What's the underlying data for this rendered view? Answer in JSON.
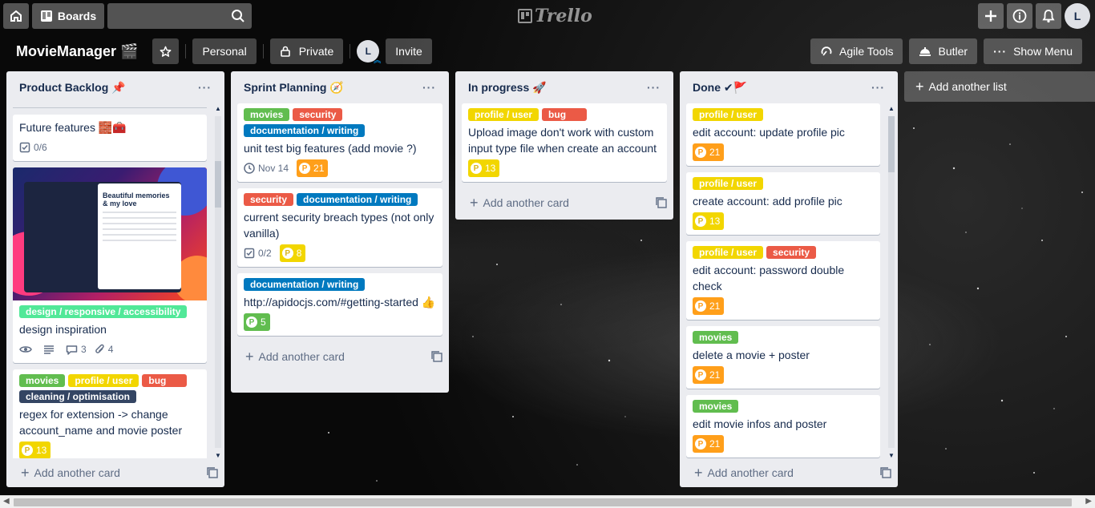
{
  "header": {
    "boards_label": "Boards",
    "search_placeholder": "",
    "logo": "Trello",
    "avatar": "L"
  },
  "board": {
    "title": "MovieManager 🎬",
    "visibility_team": "Personal",
    "visibility_privacy": "Private",
    "member": "L",
    "invite": "Invite",
    "agile_tools": "Agile Tools",
    "butler": "Butler",
    "show_menu": "Show Menu",
    "add_list": "Add another list"
  },
  "colors": {
    "green": "#61bd4f",
    "yellow": "#f2d600",
    "red": "#eb5a46",
    "blue": "#0079bf",
    "lime": "#51e898",
    "navy": "#344563",
    "orange": "#ff9f1a"
  },
  "lists": [
    {
      "title": "Product Backlog 📌",
      "add_card": "Add another card",
      "cards": [
        {
          "title": "Future features 🧱🧰",
          "checklist": "0/6"
        },
        {
          "cover_text": "Beautiful memories & my love",
          "labels": [
            {
              "text": "design / responsive / accessibility",
              "color": "lime"
            }
          ],
          "title": "design inspiration",
          "comments": "3",
          "attachments": "4"
        },
        {
          "labels": [
            {
              "text": "movies",
              "color": "green"
            },
            {
              "text": "profile / user",
              "color": "yellow"
            },
            {
              "text": "bug",
              "color": "red"
            },
            {
              "text": "cleaning / optimisation",
              "color": "navy"
            }
          ],
          "title": "regex for extension -> change account_name and movie poster",
          "points": "13"
        }
      ]
    },
    {
      "title": "Sprint Planning 🧭",
      "add_card": "Add another card",
      "cards": [
        {
          "labels": [
            {
              "text": "movies",
              "color": "green"
            },
            {
              "text": "security",
              "color": "red"
            },
            {
              "text": "documentation / writing",
              "color": "blue"
            }
          ],
          "title": "unit test big features (add movie ?)",
          "due": "Nov 14",
          "points": "21"
        },
        {
          "labels": [
            {
              "text": "security",
              "color": "red"
            },
            {
              "text": "documentation / writing",
              "color": "blue"
            }
          ],
          "title": "current security breach types (not only vanilla)",
          "checklist": "0/2",
          "points": "8"
        },
        {
          "labels": [
            {
              "text": "documentation / writing",
              "color": "blue"
            }
          ],
          "title": "http://apidocjs.com/#getting-started 👍",
          "points": "5"
        }
      ]
    },
    {
      "title": "In progress 🚀",
      "add_card": "Add another card",
      "cards": [
        {
          "labels": [
            {
              "text": "profile / user",
              "color": "yellow"
            },
            {
              "text": "bug",
              "color": "red"
            }
          ],
          "title": "Upload image don't work with custom input type file when create an account",
          "points": "13"
        }
      ]
    },
    {
      "title": "Done ✔🚩",
      "add_card": "Add another card",
      "cards": [
        {
          "labels": [
            {
              "text": "profile / user",
              "color": "yellow"
            }
          ],
          "title": "edit account: update profile pic",
          "points": "21"
        },
        {
          "labels": [
            {
              "text": "profile / user",
              "color": "yellow"
            }
          ],
          "title": "create account: add profile pic",
          "points": "13"
        },
        {
          "labels": [
            {
              "text": "profile / user",
              "color": "yellow"
            },
            {
              "text": "security",
              "color": "red"
            }
          ],
          "title": "edit account: password double check",
          "points": "21"
        },
        {
          "labels": [
            {
              "text": "movies",
              "color": "green"
            }
          ],
          "title": "delete a movie + poster",
          "points": "21"
        },
        {
          "labels": [
            {
              "text": "movies",
              "color": "green"
            }
          ],
          "title": "edit movie infos and poster",
          "points": "21"
        }
      ]
    }
  ]
}
